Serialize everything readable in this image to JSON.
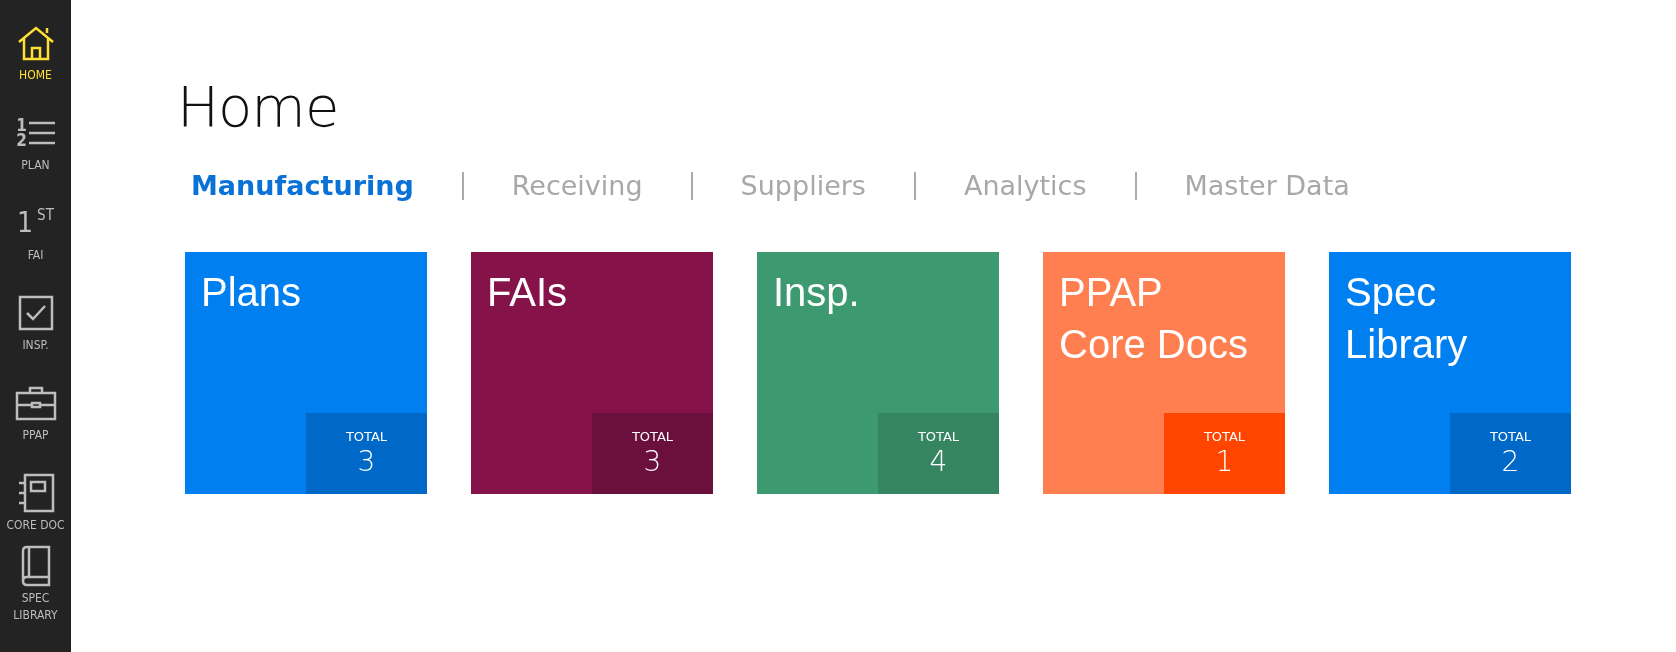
{
  "sidebar": {
    "items": [
      {
        "kind": "home",
        "label": "HOME",
        "selected": true
      },
      {
        "kind": "plan",
        "label": "PLAN",
        "selected": false,
        "icon_text": [
          "1",
          "2"
        ]
      },
      {
        "kind": "fai",
        "label": "FAI",
        "selected": false,
        "icon_text": [
          "1",
          "ST"
        ]
      },
      {
        "kind": "insp",
        "label": "INSP.",
        "selected": false
      },
      {
        "kind": "ppap",
        "label": "PPAP",
        "selected": false
      },
      {
        "kind": "coredoc",
        "label": "CORE DOC",
        "selected": false
      },
      {
        "kind": "spec",
        "label": "SPEC LIBRARY",
        "selected": false
      }
    ]
  },
  "page": {
    "title": "Home"
  },
  "tabs": [
    {
      "label": "Manufacturing",
      "selected": true
    },
    {
      "label": "Receiving",
      "selected": false
    },
    {
      "label": "Suppliers",
      "selected": false
    },
    {
      "label": "Analytics",
      "selected": false
    },
    {
      "label": "Master Data",
      "selected": false
    }
  ],
  "tiles": [
    {
      "title": "Plans",
      "color": "#0080f0",
      "total": {
        "label": "TOTAL",
        "count": "3",
        "color": "#0069c8"
      }
    },
    {
      "title": "FAIs",
      "color": "#85134a",
      "total": {
        "label": "TOTAL",
        "count": "3",
        "color": "#6b0f3c"
      }
    },
    {
      "title": "Insp.",
      "color": "#3d9970",
      "total": {
        "label": "TOTAL",
        "count": "4",
        "color": "#358561"
      }
    },
    {
      "title": "PPAP Core Docs",
      "color": "#ff7f50",
      "total": {
        "label": "TOTAL",
        "count": "1",
        "color": "#ff4500"
      }
    },
    {
      "title": "Spec Library",
      "color": "#0080f0",
      "total": {
        "label": "TOTAL",
        "count": "2",
        "color": "#0069c8"
      }
    }
  ]
}
